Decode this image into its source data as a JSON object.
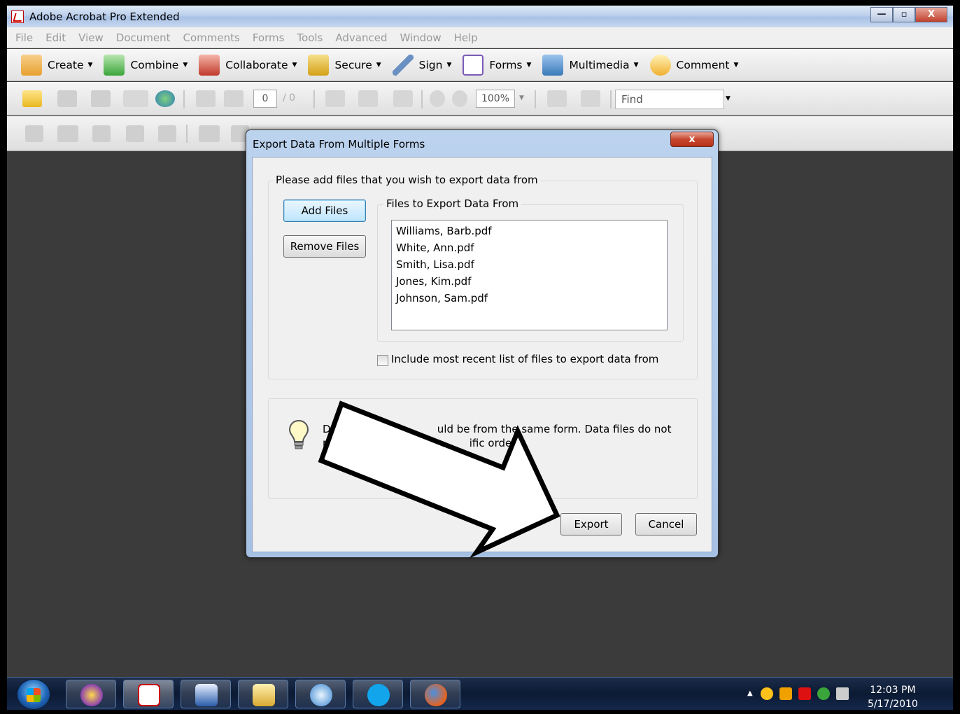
{
  "window": {
    "title": "Adobe Acrobat Pro Extended",
    "controls": {
      "minimize": "—",
      "maximize": "▫",
      "close": "X"
    }
  },
  "menu": [
    "File",
    "Edit",
    "View",
    "Document",
    "Comments",
    "Forms",
    "Tools",
    "Advanced",
    "Window",
    "Help"
  ],
  "tasks": [
    {
      "label": "Create",
      "icon": "create-icon",
      "color": "#e8a030"
    },
    {
      "label": "Combine",
      "icon": "combine-icon",
      "color": "#3aa53a"
    },
    {
      "label": "Collaborate",
      "icon": "collaborate-icon",
      "color": "#c0392b"
    },
    {
      "label": "Secure",
      "icon": "lock-icon",
      "color": "#d4a017"
    },
    {
      "label": "Sign",
      "icon": "pen-icon",
      "color": "#6a8fc2"
    },
    {
      "label": "Forms",
      "icon": "forms-icon",
      "color": "#7a5cb8"
    },
    {
      "label": "Multimedia",
      "icon": "multimedia-icon",
      "color": "#3a7ab8"
    },
    {
      "label": "Comment",
      "icon": "comment-icon",
      "color": "#f0b030"
    }
  ],
  "toolbar": {
    "page_current": "0",
    "page_total": "/ 0",
    "zoom": "100%",
    "find_placeholder": "Find"
  },
  "dialog": {
    "title": "Export Data From Multiple Forms",
    "close": "x",
    "group_label": "Please add files that you wish to export data from",
    "add_files": "Add Files",
    "remove_files": "Remove Files",
    "files_label": "Files to Export Data From",
    "files": [
      "Williams, Barb.pdf",
      "White, Ann.pdf",
      "Smith, Lisa.pdf",
      "Jones, Kim.pdf",
      "Johnson, Sam.pdf"
    ],
    "include_recent": "Include most recent list of files to export data from",
    "include_recent_checked": false,
    "hint_line1": "Da                              uld be from the same form. Data files do not",
    "hint_line2": "n                                          ific order.",
    "export": "Export",
    "cancel": "Cancel"
  },
  "taskbar": {
    "apps": [
      "yahoo-messenger-icon",
      "acrobat-icon",
      "word-icon",
      "file-explorer-icon",
      "safari-icon",
      "skype-icon",
      "firefox-icon"
    ],
    "time": "12:03 PM",
    "date": "5/17/2010"
  }
}
